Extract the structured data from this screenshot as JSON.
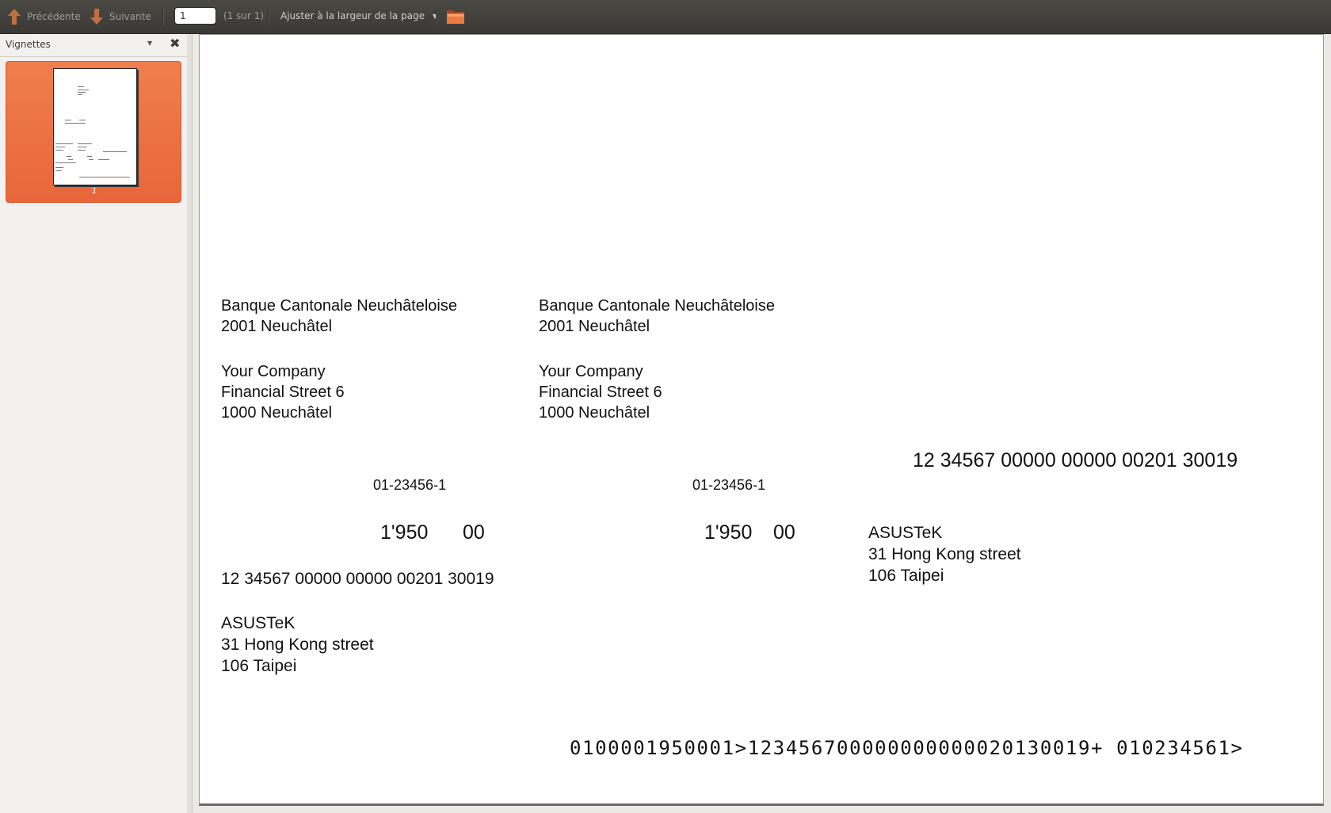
{
  "toolbar": {
    "prev_label": "Précédente",
    "next_label": "Suivante",
    "page_value": "1",
    "page_count": "(1 sur 1)",
    "zoom_label": "Ajuster à la largeur de la page"
  },
  "sidebar": {
    "title": "Vignettes",
    "thumbnails": [
      {
        "label": "1"
      }
    ]
  },
  "document": {
    "receipt": {
      "bank_name": "Banque Cantonale Neuchâteloise",
      "bank_city": "2001 Neuchâtel",
      "payee_name": "Your Company",
      "payee_street": "Financial Street 6",
      "payee_city": "1000 Neuchâtel",
      "account": "01-23456-1",
      "amount_francs": "1'950",
      "amount_cents": "00",
      "reference": "12 34567 00000 00000 00201 30019",
      "payer_name": "ASUSTeK",
      "payer_street": "31 Hong Kong street",
      "payer_city": "106 Taipei"
    },
    "payment": {
      "bank_name": "Banque Cantonale Neuchâteloise",
      "bank_city": "2001 Neuchâtel",
      "payee_name": "Your Company",
      "payee_street": "Financial Street 6",
      "payee_city": "1000 Neuchâtel",
      "account": "01-23456-1",
      "amount_francs": "1'950",
      "amount_cents": "00",
      "reference": "12 34567 00000 00000 00201 30019",
      "payer_name": "ASUSTeK",
      "payer_street": "31 Hong Kong street",
      "payer_city": "106 Taipei"
    },
    "ocr_line": "0100001950001>123456700000000000020130019+ 010234561>"
  },
  "colors": {
    "toolbar_bg": "#3c3b37",
    "accent": "#e8663a",
    "page_bg": "#ffffff"
  }
}
